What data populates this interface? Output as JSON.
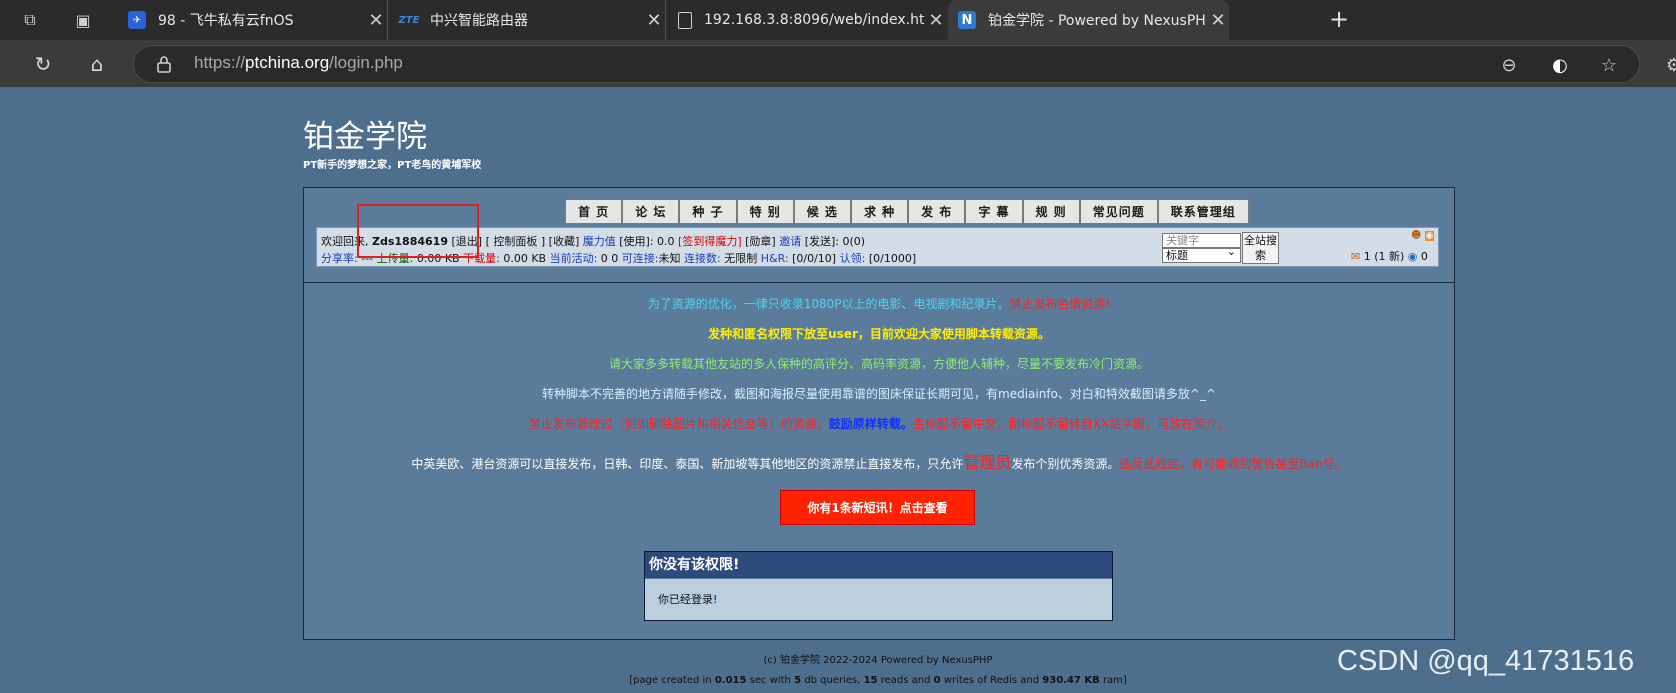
{
  "browser": {
    "tabs": [
      {
        "title": "98 - 飞牛私有云fnOS",
        "icon": "fnos-favicon"
      },
      {
        "title": "中兴智能路由器",
        "icon": "zte-favicon",
        "icon_text": "ZTE"
      },
      {
        "title": "192.168.3.8:8096/web/index.html",
        "icon": "page-icon"
      },
      {
        "title": "铂金学院 - Powered by NexusPHP",
        "icon": "nexusphp-favicon",
        "icon_text": "N"
      }
    ],
    "url_prefix": "https://",
    "url_domain": "ptchina.org",
    "url_path": "/login.php"
  },
  "site": {
    "title": "铂金学院",
    "slogan": "PT新手的梦想之家，PT老鸟的黄埔军校"
  },
  "menu": [
    "首 页",
    "论 坛",
    "种 子",
    "特 别",
    "候 选",
    "求 种",
    "发 布",
    "字 幕",
    "规 则",
    "常见问题",
    "联系管理组"
  ],
  "userbar": {
    "welcome": "欢迎回来,",
    "username": "Zds1884619",
    "logout": "[退出]",
    "control_panel": "[ 控制面板 ]",
    "favorites": "[收藏]",
    "bonus_label": "魔力值",
    "bonus_use": "[使用]: 0.0",
    "checkin": "[签到得魔力]",
    "medal": "[勋章]",
    "invite": "邀请",
    "sent": "[发送]: 0(0)",
    "ratio_label": "分享率:",
    "ratio_value": "---",
    "uploaded_label": "上传量:",
    "uploaded_value": "0.00 KB",
    "downloaded_label": "下载量:",
    "downloaded_value": "0.00 KB",
    "activity_label": "当前活动:",
    "activity_value": "0 0",
    "connectable_label": "可连接:",
    "connectable_value": "未知",
    "connections_label": "连接数:",
    "connections_value": "无限制",
    "hr_label": "H&R:",
    "hr_value": "[0/0/10]",
    "claim_label": "认领:",
    "claim_value": "[0/1000]",
    "search_placeholder": "关键字",
    "search_type": "标题",
    "search_button": "全站搜索",
    "messages": "1 (1 新)",
    "friends": "0"
  },
  "notices": [
    {
      "text": "为了资源的优化，一律只收录1080P以上的电影、电视剧和纪录片。",
      "emphasis": "禁止发布色情资源!"
    },
    {
      "text": "发种和匿名权限下放至user，目前欢迎大家使用脚本转载资源。"
    },
    {
      "text": "请大家多多转载其他友站的多人保种的高评分、高码率资源，方便他人辅种，尽量不要发布冷门资源。"
    },
    {
      "text": "转种脚本不完善的地方请随手修改，截图和海报尽量使用靠谱的图床保证长期可见，有mediainfo、对白和特效截图请多放^_^"
    },
    {
      "text": "禁止发布篡改过（例如删除图片和相关信息等）的资源。",
      "emphasis": "鼓励原样转载。",
      "tail": "主标题不留中文，副标题不留转自XX站字眼，可放在简介。"
    },
    {
      "text": "中英美欧、港台资源可以直接发布，日韩、印度、泰国、新加坡等其他地区的资源禁止直接发布，只允许",
      "emphasis": "管理员",
      "tail": "发布个别优秀资源。",
      "warning": "违反此规定，有可能收到警告甚至Ban号。"
    }
  ],
  "message_button": "你有1条新短讯！点击查看",
  "error": {
    "title": "你没有该权限!",
    "body": "你已经登录!"
  },
  "footer": {
    "copyright": "(c) 铂金学院 2022-2024 Powered by NexusPHP",
    "stats_open": "[page created in",
    "time": "0.015",
    "stats_mid1": "sec with",
    "queries": "5",
    "stats_mid2": "db queries,",
    "reads": "15",
    "stats_mid3": "reads and",
    "writes": "0",
    "stats_mid4": "writes of Redis and",
    "ram": "930.47 KB",
    "stats_close": "ram]"
  },
  "watermark": "CSDN @qq_41731516",
  "colors": {
    "accent_red": "#ff2200",
    "highlight_box": "#e02020",
    "page_bg": "#4e6e8e"
  }
}
